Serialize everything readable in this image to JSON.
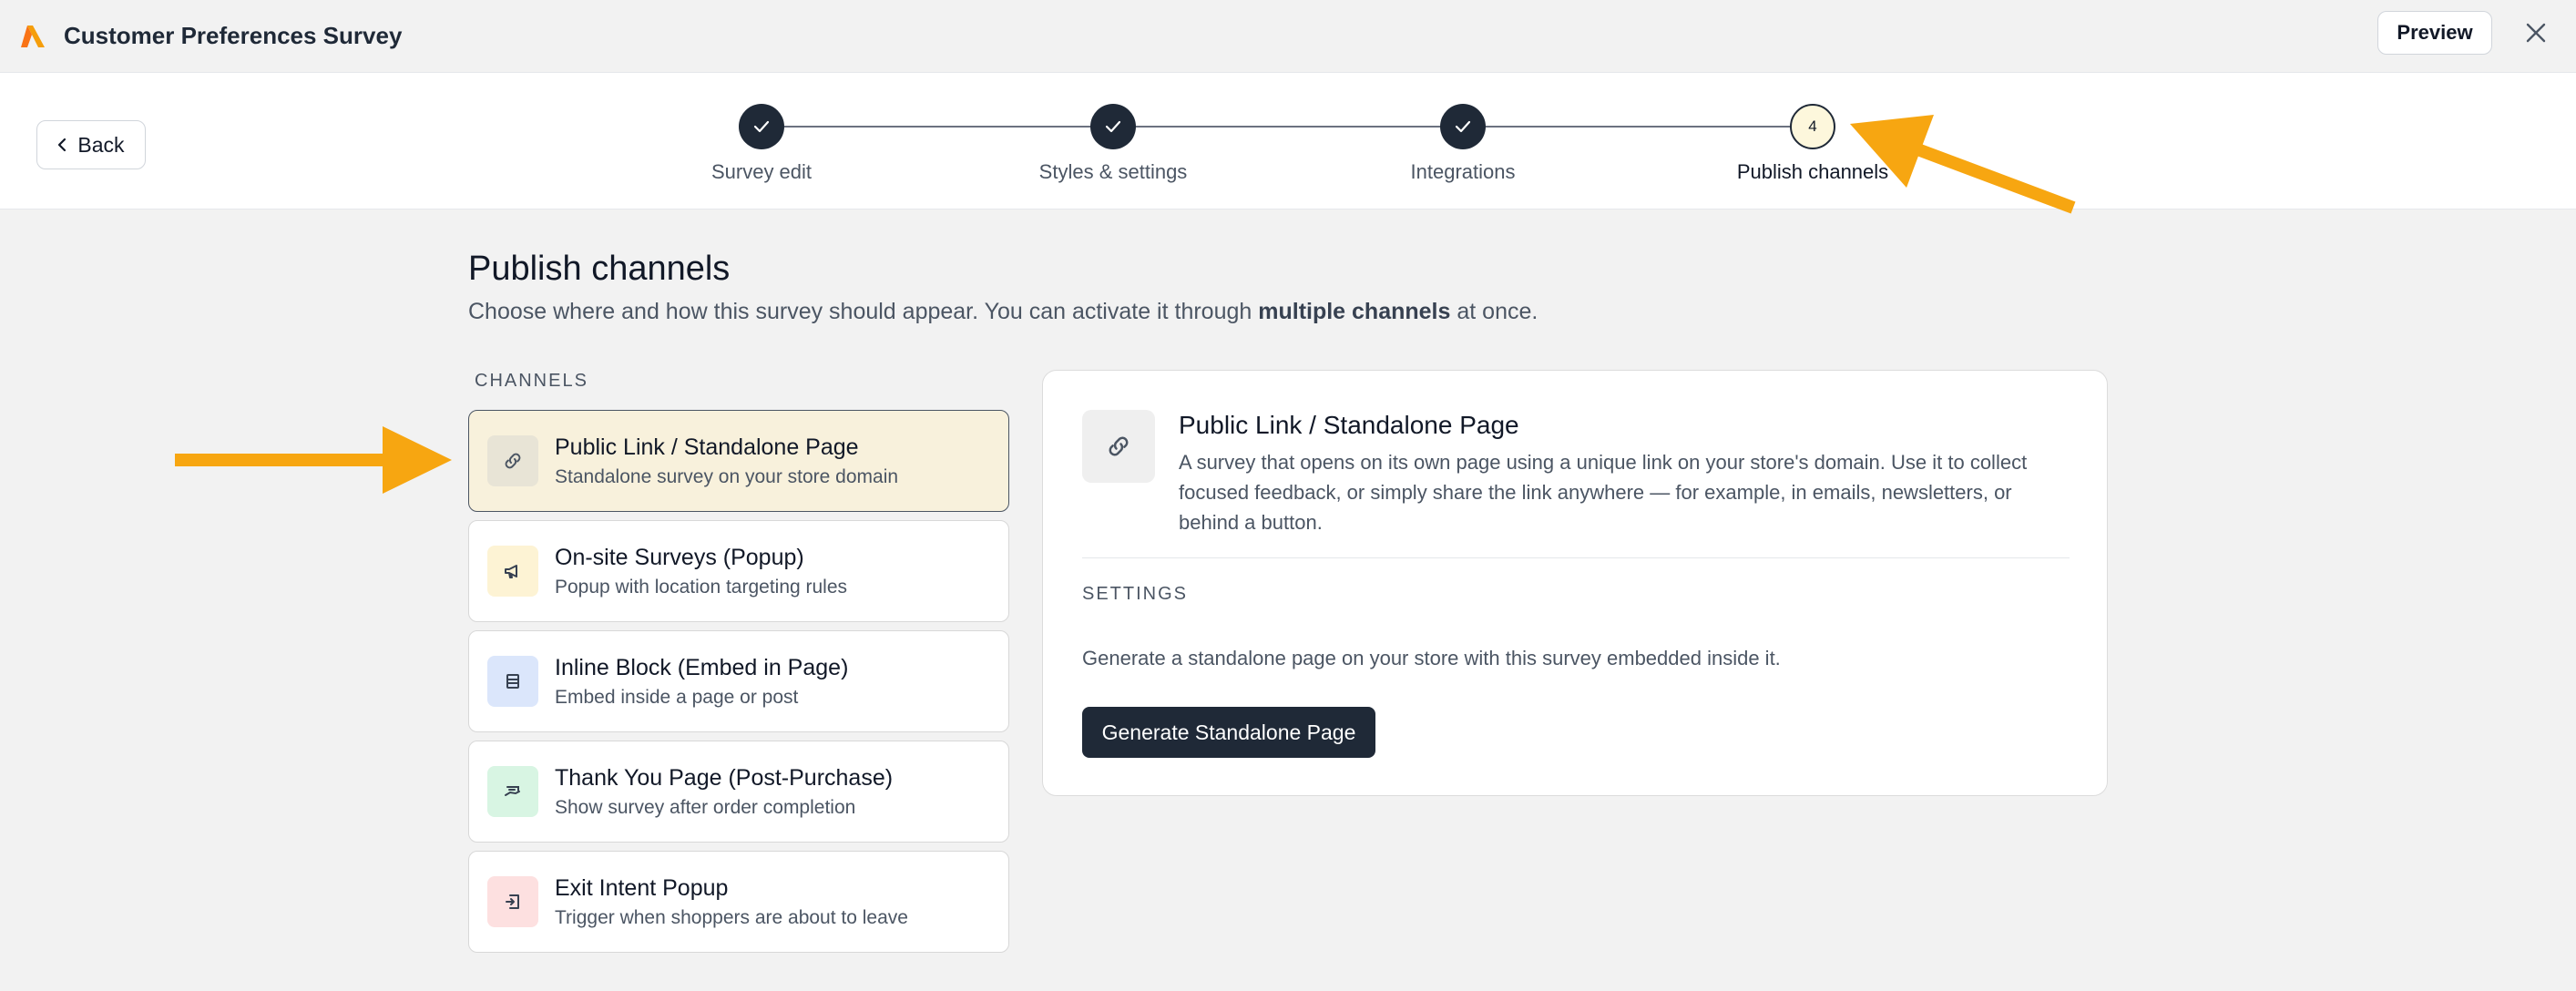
{
  "app": {
    "title": "Customer Preferences Survey",
    "preview_label": "Preview",
    "accent_color": "#f59e0b"
  },
  "nav": {
    "back_label": "Back"
  },
  "stepper": {
    "steps": [
      {
        "label": "Survey edit",
        "state": "done"
      },
      {
        "label": "Styles & settings",
        "state": "done"
      },
      {
        "label": "Integrations",
        "state": "done"
      },
      {
        "label": "Publish channels",
        "state": "active",
        "number": "4"
      }
    ]
  },
  "main": {
    "title": "Publish channels",
    "subtitle_prefix": "Choose where and how this survey should appear. You can activate it through ",
    "subtitle_bold": "multiple channels",
    "subtitle_suffix": " at once.",
    "channels_heading": "CHANNELS",
    "channels": [
      {
        "title": "Public Link / Standalone Page",
        "desc": "Standalone survey on your store domain",
        "icon": "link-icon",
        "selected": true
      },
      {
        "title": "On-site Surveys (Popup)",
        "desc": "Popup with location targeting rules",
        "icon": "megaphone-icon"
      },
      {
        "title": "Inline Block (Embed in Page)",
        "desc": "Embed inside a page or post",
        "icon": "embed-block-icon"
      },
      {
        "title": "Thank You Page (Post-Purchase)",
        "desc": "Show survey after order completion",
        "icon": "receipt-hand-icon"
      },
      {
        "title": "Exit Intent Popup",
        "desc": "Trigger when shoppers are about to leave",
        "icon": "exit-icon"
      }
    ]
  },
  "detail": {
    "title": "Public Link / Standalone Page",
    "description": "A survey that opens on its own page using a unique link on your store's domain. Use it to collect focused feedback, or simply share the link anywhere — for example, in emails, newsletters, or behind a button.",
    "settings_heading": "SETTINGS",
    "settings_text": "Generate a standalone page on your store with this survey embedded inside it.",
    "generate_label": "Generate Standalone Page"
  }
}
